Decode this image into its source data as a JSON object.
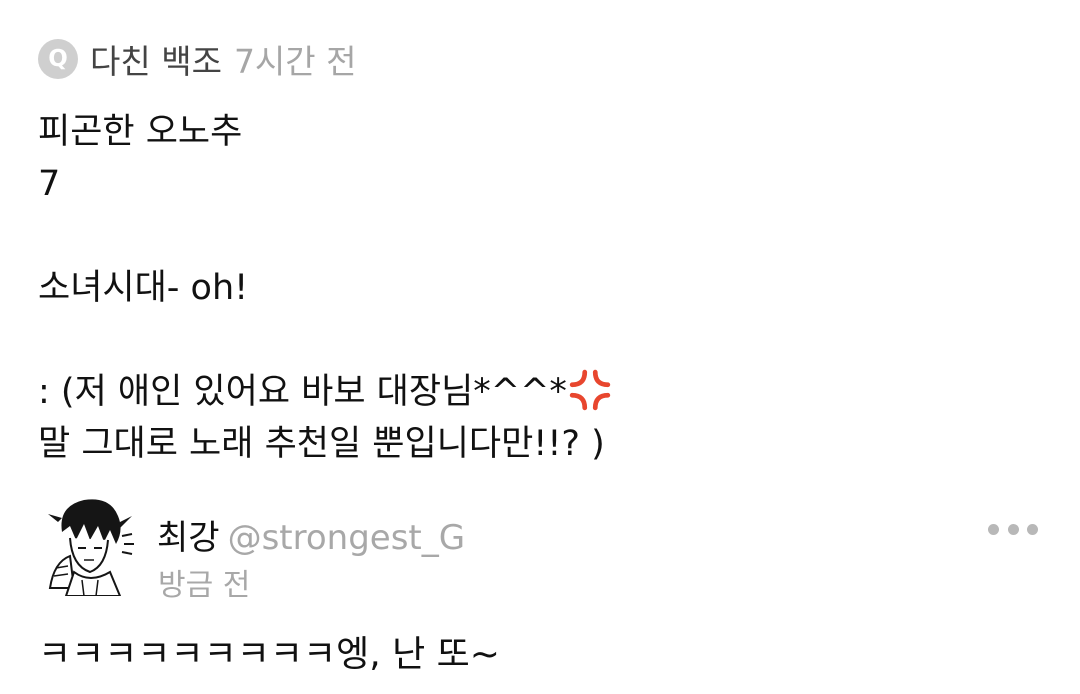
{
  "question": {
    "badge": "Q",
    "asker": "다친 백조",
    "time": "7시간 전",
    "lines": [
      "피곤한 오노추",
      "7",
      "",
      "소녀시대- oh!",
      "",
      ": (저 애인 있어요 바보 대장님*^^*",
      "말 그대로 노래 추천일 뿐입니다만!!? )"
    ],
    "emoji_icon": "anger-symbol-icon"
  },
  "answer": {
    "name": "최강",
    "handle": "@strongest_G",
    "time": "방금 전",
    "text": "ㅋㅋㅋㅋㅋㅋㅋㅋㅋ엥, 난 또~",
    "avatar_icon": "avatar-illustration",
    "more_icon": "more-dots-icon"
  },
  "colors": {
    "badge_bg": "#cfcfcf",
    "muted_text": "#a8a8a8",
    "primary_text": "#111111",
    "anger_red": "#e8462e"
  }
}
